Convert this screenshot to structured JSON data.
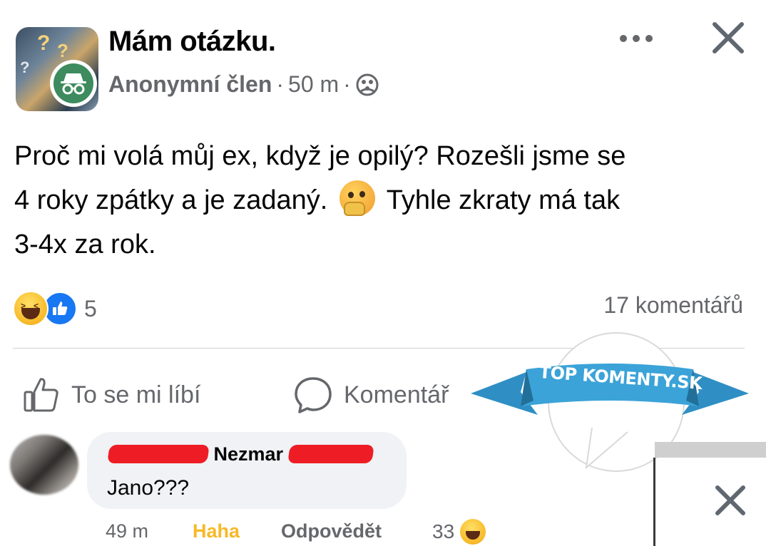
{
  "header": {
    "title": "Mám otázku.",
    "author": "Anonymní člen",
    "separator": "·",
    "time": "50 m"
  },
  "post": {
    "line1": "Proč mi volá můj ex, když je opilý? Rozešli jsme se",
    "line2_before": "4 roky zpátky a je zadaný.",
    "line2_after": "Tyhle zkraty má tak",
    "line3": "3-4x za rok."
  },
  "reactions": {
    "count": "5",
    "types": [
      "haha",
      "like"
    ]
  },
  "comments_summary": "17 komentářů",
  "actions": {
    "like_label": "To se mi líbí",
    "comment_label": "Komentář"
  },
  "watermark": {
    "text": "TOP KOMENTY.SK",
    "ribbon_color": "#3ba3d8"
  },
  "comment": {
    "name_visible": "Nezmar",
    "text": "Jano???",
    "time": "49 m",
    "reaction_label": "Haha",
    "reply_label": "Odpovědět",
    "reaction_count": "33"
  },
  "colors": {
    "secondary_text": "#65676b",
    "like_blue": "#1877f2",
    "haha_yellow": "#f7b928",
    "redaction_red": "#ee1d25"
  }
}
